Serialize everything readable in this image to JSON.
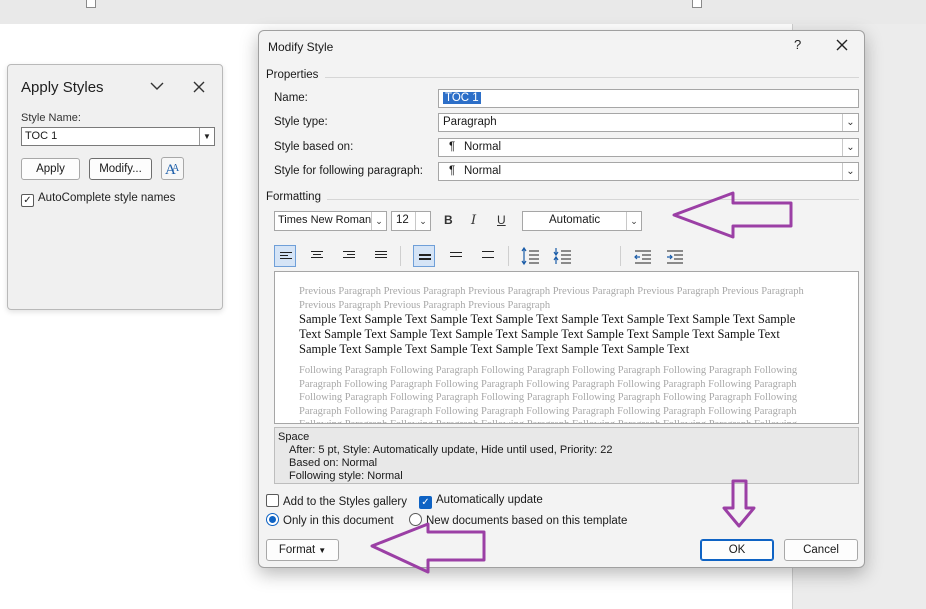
{
  "apply_styles": {
    "title": "Apply Styles",
    "style_name_label": "Style Name:",
    "style_name_value": "TOC 1",
    "apply_label": "Apply",
    "modify_label": "Modify...",
    "autocomplete_label": "AutoComplete style names",
    "autocomplete_checked": true
  },
  "dialog": {
    "title": "Modify Style",
    "help": "?",
    "close": "✕",
    "properties_label": "Properties",
    "fields": {
      "name_label": "Name:",
      "name_value": "TOC 1",
      "style_type_label": "Style type:",
      "style_type_value": "Paragraph",
      "based_on_label": "Style based on:",
      "based_on_value": "Normal",
      "following_label": "Style for following paragraph:",
      "following_value": "Normal",
      "pilcrow": "¶"
    },
    "formatting_label": "Formatting",
    "font": "Times New Roman",
    "size": "12",
    "bold": "B",
    "italic": "I",
    "underline": "U",
    "color": "Automatic",
    "preview": {
      "previous": "Previous Paragraph Previous Paragraph Previous Paragraph Previous Paragraph Previous Paragraph Previous Paragraph Previous Paragraph Previous Paragraph Previous Paragraph",
      "sample": "Sample Text Sample Text Sample Text Sample Text Sample Text Sample Text Sample Text Sample Text Sample Text Sample Text Sample Text Sample Text Sample Text Sample Text Sample Text Sample Text Sample Text Sample Text Sample Text Sample Text Sample Text",
      "following": "Following Paragraph Following Paragraph Following Paragraph Following Paragraph Following Paragraph Following Paragraph Following Paragraph Following Paragraph Following Paragraph Following Paragraph Following Paragraph Following Paragraph Following Paragraph Following Paragraph Following Paragraph Following Paragraph Following Paragraph Following Paragraph Following Paragraph Following Paragraph Following Paragraph Following Paragraph Following Paragraph Following Paragraph Following Paragraph Following Paragraph Following Paragraph Following Paragraph Following Paragraph Following Paragraph"
    },
    "description": {
      "line1": "Space",
      "line2": "After:  5 pt, Style: Automatically update, Hide until used, Priority: 22",
      "line3": "Based on: Normal",
      "line4": "Following style: Normal"
    },
    "add_to_gallery_label": "Add to the Styles gallery",
    "add_to_gallery_checked": false,
    "auto_update_label": "Automatically update",
    "auto_update_checked": true,
    "only_this_doc_label": "Only in this document",
    "new_docs_label": "New documents based on this template",
    "scope_selected": "only_this_document",
    "format_label": "Format",
    "ok_label": "OK",
    "cancel_label": "Cancel"
  },
  "colors": {
    "accent": "#0f63c4",
    "annotation_arrow": "#9b3fa5",
    "selection": "#2d6fc8"
  }
}
